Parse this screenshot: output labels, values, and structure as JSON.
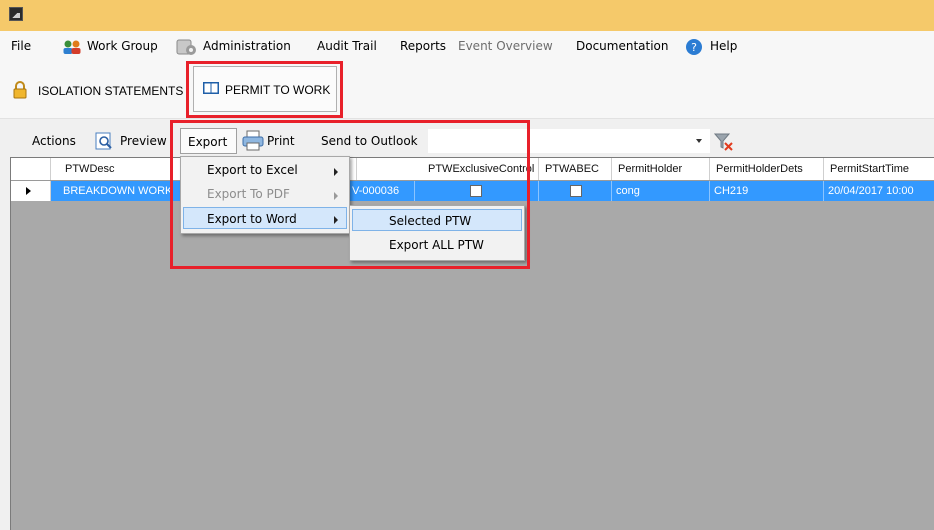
{
  "menu": {
    "file": "File",
    "work_group": "Work Group",
    "administration": "Administration",
    "audit_trail": "Audit Trail",
    "reports": "Reports",
    "event_overview": "Event Overview",
    "documentation": "Documentation",
    "help": "Help"
  },
  "ribbon": {
    "tabs": [
      {
        "label": "ISOLATION STATEMENTS",
        "icon": "padlock-icon"
      },
      {
        "label": "PERMIT TO WORK",
        "icon": "book-icon"
      }
    ]
  },
  "toolbar": {
    "actions": "Actions",
    "preview": "Preview",
    "export": "Export",
    "print": "Print",
    "send_to_outlook": "Send to Outlook",
    "filter_value": "",
    "clear_filter_icon": "filter-clear-icon"
  },
  "grid": {
    "columns": [
      "PTWDesc",
      "PTWExclusiveControl",
      "PTWABEC",
      "PermitHolder",
      "PermitHolderDets",
      "PermitStartTime"
    ],
    "rows": [
      {
        "desc": "BREAKDOWN WORK",
        "ptw_no": "V-000036",
        "exclusive": false,
        "abec": false,
        "holder": "cong",
        "holder_dets": "CH219",
        "start_time": "20/04/2017 10:00"
      }
    ]
  },
  "export_menu": {
    "items": [
      {
        "label": "Export to Excel",
        "enabled": true
      },
      {
        "label": "Export To PDF",
        "enabled": false
      },
      {
        "label": "Export to Word",
        "enabled": true
      }
    ],
    "word_submenu": [
      "Selected PTW",
      "Export ALL PTW"
    ]
  },
  "colors": {
    "titlebar": "#f5c96a",
    "selection": "#3399ff",
    "highlight": "#e8202a"
  }
}
